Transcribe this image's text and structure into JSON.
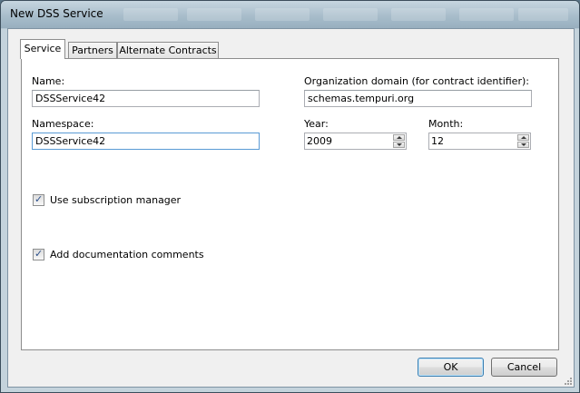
{
  "window": {
    "title": "New DSS Service"
  },
  "tabs": [
    {
      "label": "Service",
      "active": true
    },
    {
      "label": "Partners",
      "active": false
    },
    {
      "label": "Alternate Contracts",
      "active": false
    }
  ],
  "form": {
    "name": {
      "label": "Name:",
      "value": "DSSService42"
    },
    "namespace": {
      "label": "Namespace:",
      "value": "DSSService42"
    },
    "org_domain": {
      "label": "Organization domain (for contract identifier):",
      "value": "schemas.tempuri.org"
    },
    "year": {
      "label": "Year:",
      "value": "2009"
    },
    "month": {
      "label": "Month:",
      "value": "12"
    },
    "use_subscription": {
      "label": "Use subscription manager",
      "checked": true
    },
    "add_docs": {
      "label": "Add documentation comments",
      "checked": true
    }
  },
  "buttons": {
    "ok": "OK",
    "cancel": "Cancel"
  },
  "glyphs": {
    "check": "✓"
  }
}
